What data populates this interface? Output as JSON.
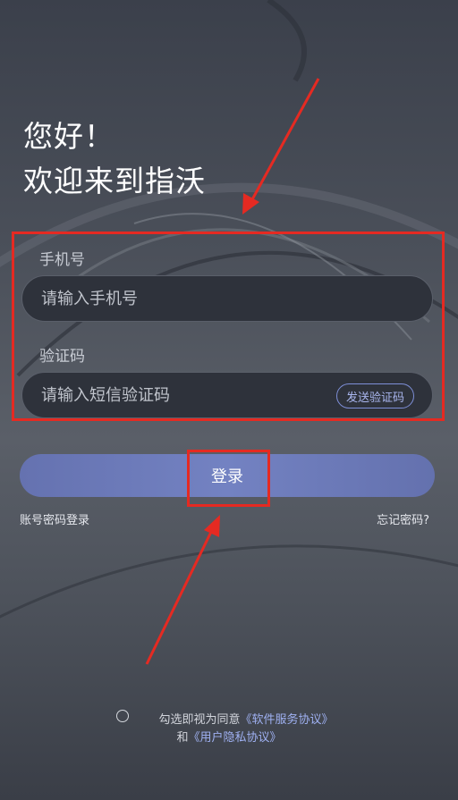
{
  "header": {
    "greeting_line1": "您好！",
    "greeting_line2": "欢迎来到指沃"
  },
  "form": {
    "phone": {
      "label": "手机号",
      "placeholder": "请输入手机号"
    },
    "code": {
      "label": "验证码",
      "placeholder": "请输入短信验证码",
      "send_button": "发送验证码"
    },
    "login_button": "登录"
  },
  "links": {
    "password_login": "账号密码登录",
    "forgot_password": "忘记密码?"
  },
  "agreement": {
    "prefix": "勾选即视为同意",
    "service_link": "《软件服务协议》",
    "and": "和",
    "privacy_link": "《用户隐私协议》",
    "checked": false
  },
  "colors": {
    "accent": "#6e7dc0",
    "link": "#9fb1f2",
    "annotation": "#e52a22"
  }
}
